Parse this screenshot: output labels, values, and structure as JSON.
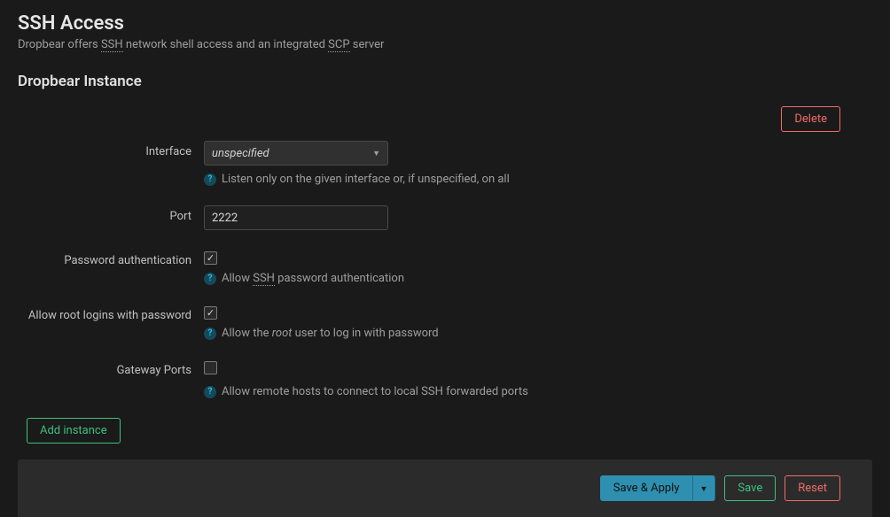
{
  "header": {
    "title": "SSH Access",
    "subtitle_pre": "Dropbear offers ",
    "subtitle_ssh": "SSH",
    "subtitle_mid": " network shell access and an integrated ",
    "subtitle_scp": "SCP",
    "subtitle_post": " server"
  },
  "section": {
    "title": "Dropbear Instance",
    "delete": "Delete",
    "add": "Add instance"
  },
  "form": {
    "interface": {
      "label": "Interface",
      "value": "unspecified",
      "hint": "Listen only on the given interface or, if unspecified, on all"
    },
    "port": {
      "label": "Port",
      "value": "2222"
    },
    "password_auth": {
      "label": "Password authentication",
      "hint_pre": "Allow ",
      "hint_ssh": "SSH",
      "hint_post": " password authentication"
    },
    "root_login": {
      "label": "Allow root logins with password",
      "hint_pre": "Allow the ",
      "hint_root": "root",
      "hint_post": " user to log in with password"
    },
    "gateway": {
      "label": "Gateway Ports",
      "hint": "Allow remote hosts to connect to local SSH forwarded ports"
    }
  },
  "actions": {
    "save_apply": "Save & Apply",
    "save": "Save",
    "reset": "Reset"
  }
}
